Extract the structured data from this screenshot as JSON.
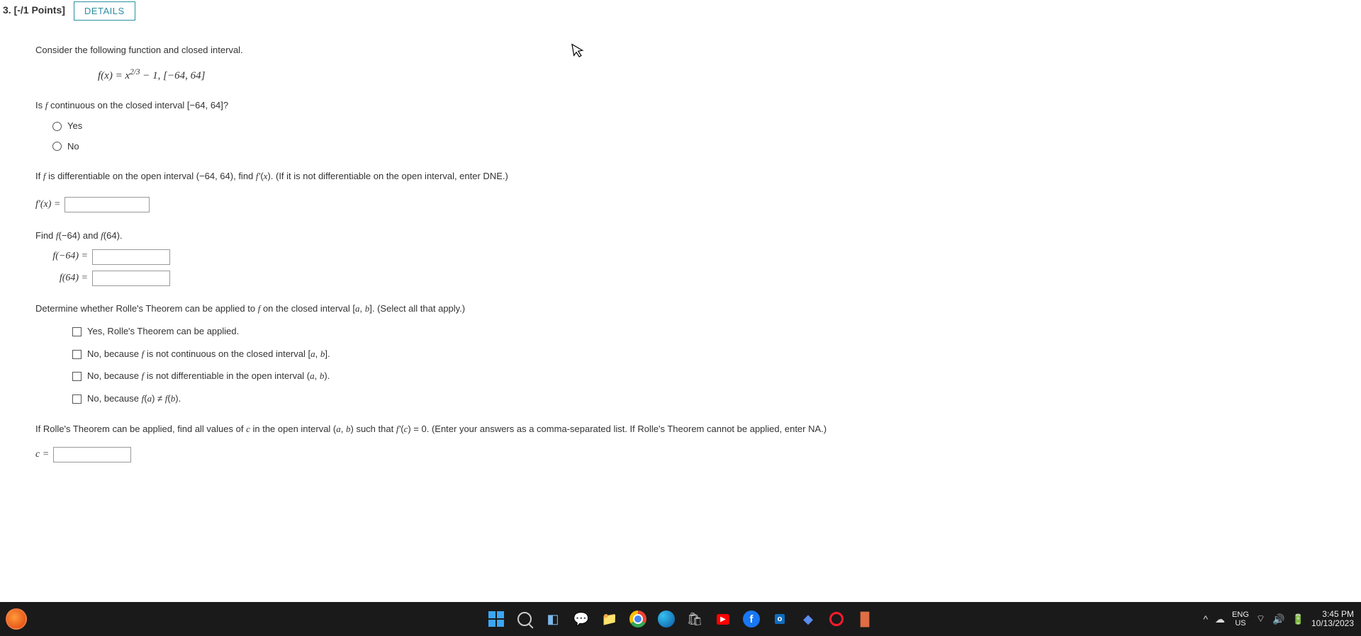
{
  "header": {
    "number": "3.",
    "points": "[-/1 Points]",
    "details_btn": "DETAILS"
  },
  "intro": "Consider the following function and closed interval.",
  "formula": {
    "lhs": "f(x) = x",
    "exp": "2/3",
    "rest": " − 1,    [−64, 64]"
  },
  "q_continuous": {
    "prompt_pre": "Is ",
    "prompt_f": "f",
    "prompt_post": " continuous on the closed interval [−64, 64]?",
    "opt_yes": "Yes",
    "opt_no": "No"
  },
  "q_differentiable": {
    "prompt": "If f is differentiable on the open interval (−64, 64), find f'(x). (If it is not differentiable on the open interval, enter DNE.)",
    "label": "f'(x) ="
  },
  "q_endpoints": {
    "prompt": "Find f(−64) and f(64).",
    "label_a": "f(−64)  =",
    "label_b": "f(64)  ="
  },
  "q_rolle": {
    "prompt": "Determine whether Rolle's Theorem can be applied to f on the closed interval [a, b]. (Select all that apply.)",
    "opts": [
      "Yes, Rolle's Theorem can be applied.",
      "No, because f is not continuous on the closed interval [a, b].",
      "No, because f is not differentiable in the open interval (a, b).",
      "No, because f(a) ≠ f(b)."
    ]
  },
  "q_cvalues": {
    "prompt": "If Rolle's Theorem can be applied, find all values of c in the open interval (a, b) such that f'(c) = 0. (Enter your answers as a comma-separated list. If Rolle's Theorem cannot be applied, enter NA.)",
    "label": "c ="
  },
  "taskbar": {
    "lang_top": "ENG",
    "lang_bot": "US",
    "time": "3:45 PM",
    "date": "10/13/2023"
  }
}
